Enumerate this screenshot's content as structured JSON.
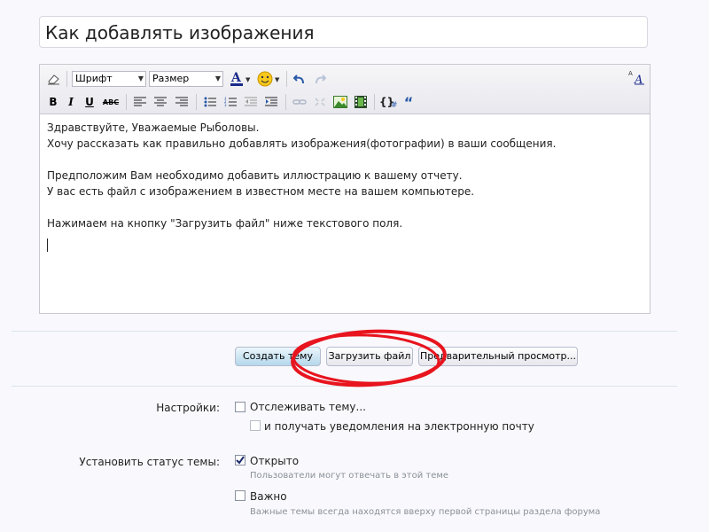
{
  "thread_title": "Как добавлять изображения",
  "toolbar": {
    "font_label": "Шрифт",
    "size_label": "Размер"
  },
  "editor": {
    "lines": [
      "Здравствуйте, Уважаемые Рыболовы.",
      "Хочу рассказать как правильно добавлять изображения(фотографии) в ваши сообщения.",
      "",
      "Предположим Вам необходимо добавить иллюстрацию к вашему отчету.",
      "У вас есть файл с изображением в известном месте на вашем компьютере.",
      "",
      "Нажимаем на кнопку \"Загрузить файл\" ниже текстового поля."
    ]
  },
  "buttons": {
    "create": "Создать тему",
    "upload": "Загрузить файл",
    "preview": "Предварительный просмотр..."
  },
  "settings": {
    "label": "Настройки:",
    "watch_thread": "Отслеживать тему...",
    "email_notify": "и получать уведомления на электронную почту",
    "watch_checked": false,
    "email_checked": false
  },
  "status": {
    "label": "Установить статус темы:",
    "open": "Открыто",
    "open_hint": "Пользователи могут отвечать в этой теме",
    "open_checked": true,
    "important": "Важно",
    "important_hint": "Важные темы всегда находятся вверху первой страницы раздела форума",
    "important_checked": false
  },
  "annotation_color": "#e8141e"
}
